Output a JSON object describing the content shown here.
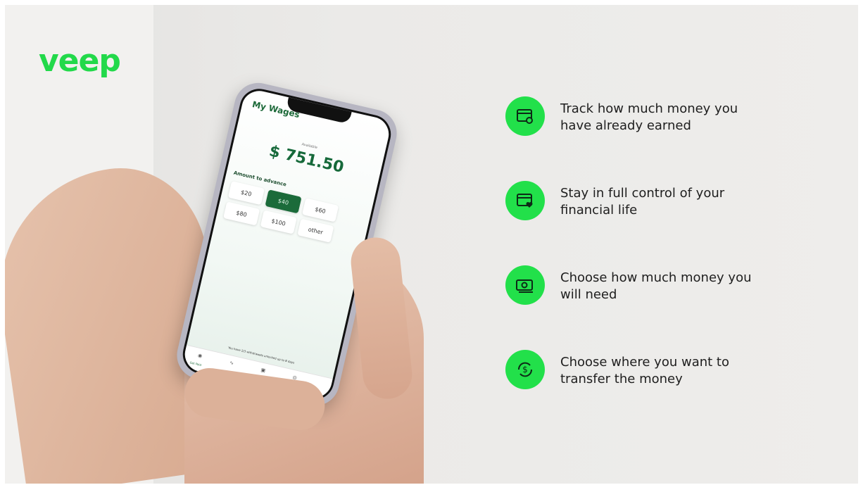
{
  "brand": {
    "logo_text": "veep",
    "accent": "#22e04a"
  },
  "phone": {
    "app_title": "My Wages",
    "available_label": "Available",
    "balance": "$ 751.50",
    "advance_label": "Amount to advance",
    "amounts": [
      "$20",
      "$40",
      "$60",
      "$80",
      "$100",
      "other"
    ],
    "selected_amount": "$40",
    "bottom_note": "You have 2/3 withdrawals unlocked up to 8 days",
    "nav": {
      "items": [
        "home-icon",
        "chart-icon",
        "wallet-icon",
        "profile-icon"
      ],
      "home_label": "Get Paid"
    }
  },
  "features": [
    {
      "icon": "card-settings-icon",
      "line1": "Track how much money you",
      "line2": "have already earned"
    },
    {
      "icon": "card-heart-icon",
      "line1": "Stay in full control of your",
      "line2": "financial life"
    },
    {
      "icon": "cash-icon",
      "line1": "Choose how much money you",
      "line2": "will need"
    },
    {
      "icon": "dollar-transfer-icon",
      "line1": "Choose where you want to",
      "line2": "transfer the money"
    }
  ]
}
